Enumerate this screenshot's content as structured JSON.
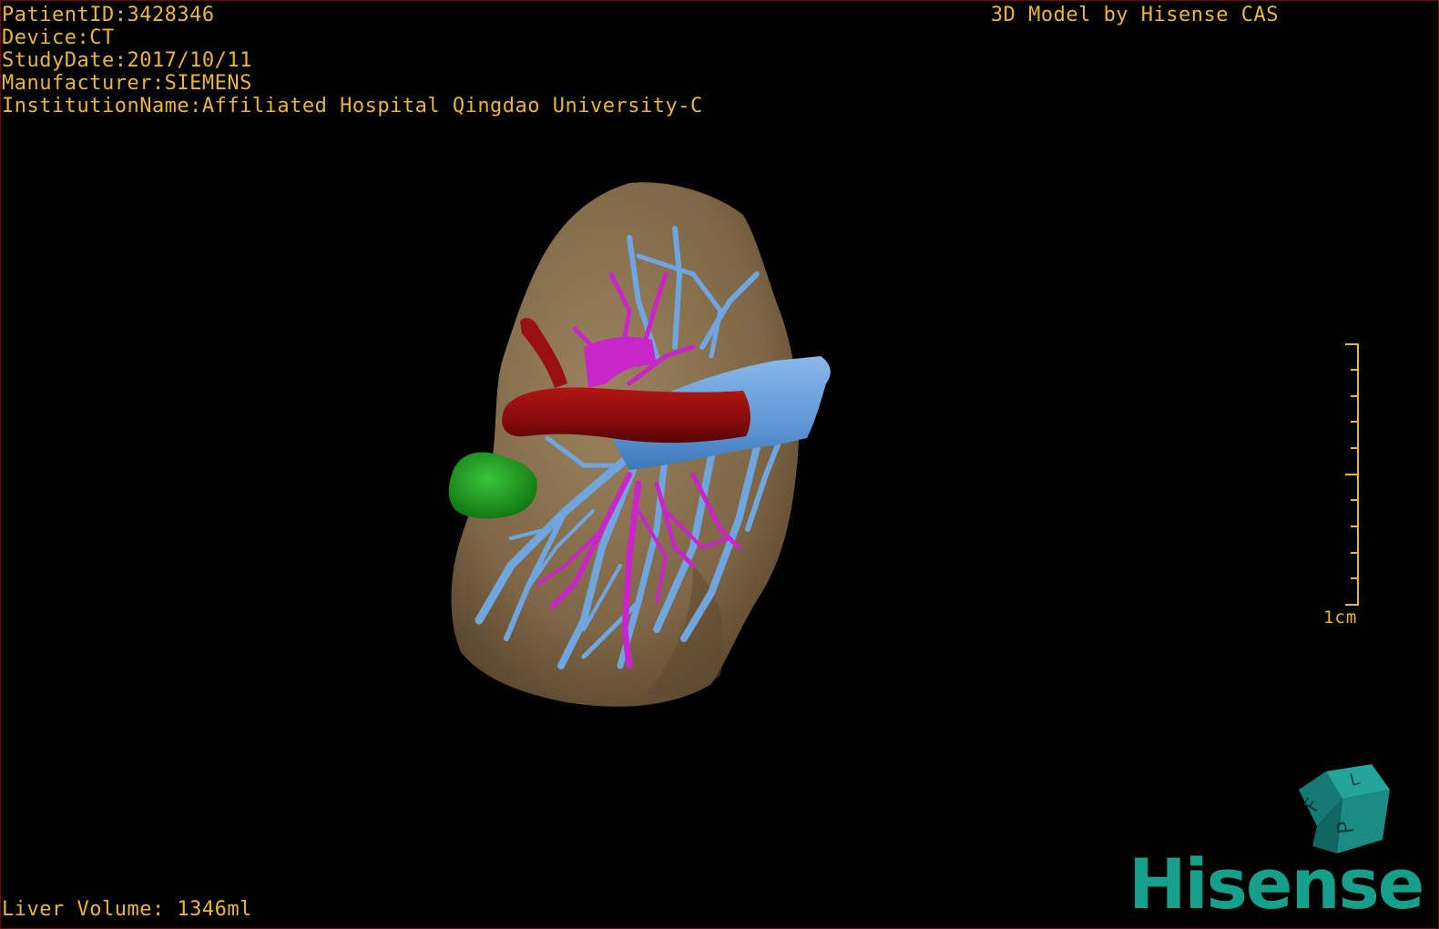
{
  "patient_info": {
    "patient_id": "PatientID:3428346",
    "device": "Device:CT",
    "study_date": "StudyDate:2017/10/11",
    "manufacturer": "Manufacturer:SIEMENS",
    "institution": "InstitutionName:Affiliated Hospital Qingdao University-C"
  },
  "header_right": "3D Model by Hisense CAS",
  "liver_volume": "Liver Volume: 1346ml",
  "scale": {
    "label": "1cm"
  },
  "orientation_cube": {
    "faces": [
      "F",
      "L",
      "P"
    ]
  },
  "logo": {
    "text": "Hisense",
    "color": "#16a08c"
  },
  "colors": {
    "overlay_text": "#e8b63a",
    "liver": "#8a7150",
    "portal_vein": "#6fa6e0",
    "hepatic_artery": "#c826c8",
    "tumor_red": "#8e0c0c",
    "tumor_green": "#1e9e1e",
    "cube": "#1a8c84"
  },
  "icons": {
    "cube": "orientation-cube-icon",
    "logo": "hisense-logo"
  }
}
